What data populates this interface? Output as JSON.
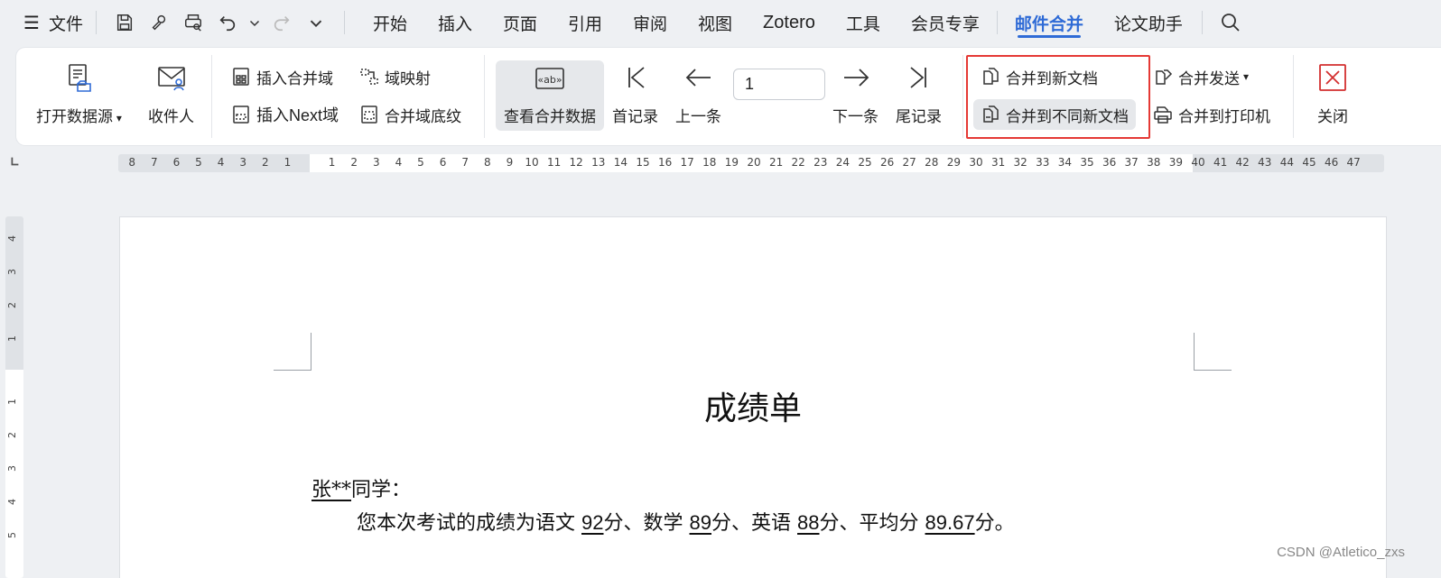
{
  "menu": {
    "file_label": "文件",
    "tabs": [
      {
        "label": "开始"
      },
      {
        "label": "插入"
      },
      {
        "label": "页面"
      },
      {
        "label": "引用"
      },
      {
        "label": "审阅"
      },
      {
        "label": "视图"
      },
      {
        "label": "Zotero"
      },
      {
        "label": "工具"
      },
      {
        "label": "会员专享"
      },
      {
        "label": "邮件合并"
      },
      {
        "label": "论文助手"
      }
    ],
    "active_tab": "邮件合并"
  },
  "ribbon": {
    "open_source": "打开数据源",
    "recipients": "收件人",
    "insert_merge_field": "插入合并域",
    "field_mapping": "域映射",
    "insert_next_field": "插入Next域",
    "field_shading": "合并域底纹",
    "view_merge_data": "查看合并数据",
    "first_record": "首记录",
    "prev_record": "上一条",
    "record_value": "1",
    "next_record": "下一条",
    "last_record": "尾记录",
    "merge_new_doc": "合并到新文档",
    "merge_diff_docs": "合并到不同新文档",
    "merge_send": "合并发送",
    "merge_printer": "合并到打印机",
    "close": "关闭"
  },
  "ruler": {
    "left_ticks": [
      "8",
      "7",
      "6",
      "5",
      "4",
      "3",
      "2",
      "1"
    ],
    "right_ticks": [
      "1",
      "2",
      "3",
      "4",
      "5",
      "6",
      "7",
      "8",
      "9",
      "10",
      "11",
      "12",
      "13",
      "14",
      "15",
      "16",
      "17",
      "18",
      "19",
      "20",
      "21",
      "22",
      "23",
      "24",
      "25",
      "26",
      "27",
      "28",
      "29",
      "30",
      "31",
      "32",
      "33",
      "34",
      "35",
      "36",
      "37",
      "38",
      "39",
      "40",
      "41",
      "42",
      "43",
      "44",
      "45",
      "46",
      "47"
    ],
    "v_top_ticks": [
      "4",
      "3",
      "2",
      "1"
    ],
    "v_bottom_ticks": [
      "1",
      "2",
      "3",
      "4",
      "5"
    ]
  },
  "document": {
    "title": "成绩单",
    "student": "张**",
    "salutation": "同学：",
    "text_intro": "您本次考试的成绩为语文",
    "chinese": "92",
    "sep1": "分、数学",
    "math": "89",
    "sep2": "分、英语",
    "english": "88",
    "sep3": "分、平均分",
    "average": "89.67",
    "end": "分。"
  },
  "watermark": "CSDN @Atletico_zxs"
}
